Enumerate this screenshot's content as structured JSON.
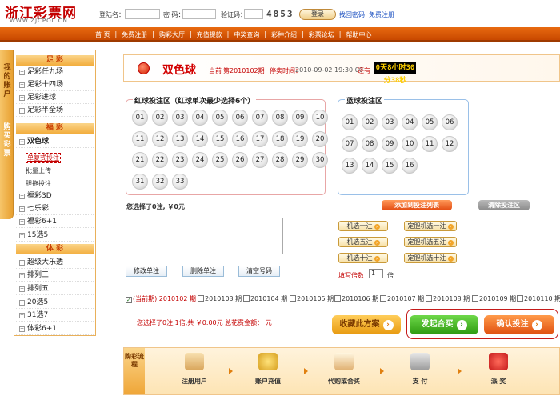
{
  "header": {
    "logo_cn": "浙江彩票网",
    "logo_en": "WWW.ZJCPOL.CN",
    "username_label": "登陆名：",
    "password_label": "密 码：",
    "captcha_label": "验证码：",
    "captcha": "4853",
    "login": "登录",
    "forgot": "找回密码",
    "register": "免费注册"
  },
  "nav": [
    "首 页",
    "免费注册",
    "购彩大厅",
    "充值提款",
    "中奖查询",
    "彩种介绍",
    "彩票论坛",
    "帮助中心"
  ],
  "left_tab": {
    "top": "我的账户",
    "bottom": "购买彩票"
  },
  "sidebar": {
    "zucai": "足 彩",
    "zucai_items": [
      "足彩任九场",
      "足彩十四场",
      "足彩进球",
      "足彩半全场"
    ],
    "fucai": "福 彩",
    "ssq": "双色球",
    "ssq_sub": [
      "单复式投注",
      "批量上传",
      "胆拖投注"
    ],
    "fucai_items": [
      "福彩3D",
      "七乐彩",
      "福彩6+1",
      "15选5"
    ],
    "ticai": "体 彩",
    "ticai_items": [
      "超级大乐透",
      "排列三",
      "排列五",
      "20选5",
      "31选7",
      "体彩6+1"
    ]
  },
  "game": {
    "title": "双色球",
    "current_label": "当前",
    "period": "第2010102期",
    "deadline_label": "停卖时间：",
    "deadline": "2010-09-02 19:30:00",
    "remaining_label": "还有",
    "countdown": "0天8小时30分38秒"
  },
  "red": {
    "title": "红球投注区（红球单次最少选择6个）",
    "balls": [
      "01",
      "02",
      "03",
      "04",
      "05",
      "06",
      "07",
      "08",
      "09",
      "10",
      "11",
      "12",
      "13",
      "14",
      "15",
      "16",
      "17",
      "18",
      "19",
      "20",
      "21",
      "22",
      "23",
      "24",
      "25",
      "26",
      "27",
      "28",
      "29",
      "30",
      "31",
      "32",
      "33"
    ]
  },
  "blue": {
    "title": "蓝球投注区",
    "balls": [
      "01",
      "02",
      "03",
      "04",
      "05",
      "06",
      "07",
      "08",
      "09",
      "10",
      "11",
      "12",
      "13",
      "14",
      "15",
      "16"
    ]
  },
  "actions": {
    "add": "添加到投注列表",
    "clear": "清除投注区"
  },
  "selected_text": "您选择了0注, ￥0元",
  "list_buttons": {
    "modify": "修改单注",
    "delete": "删除单注",
    "clear": "清空号码"
  },
  "random_buttons": [
    "机选一注",
    "定胆机选一注",
    "机选五注",
    "定胆机选五注",
    "机选十注",
    "定胆机选十注"
  ],
  "multiple_label": "填写倍数",
  "multiple_value": "1",
  "multiple_unit": "倍",
  "periods": [
    "(当前期) 2010102 期",
    "2010103 期",
    "2010104 期",
    "2010105 期",
    "2010106 期",
    "2010107 期",
    "2010108 期",
    "2010109 期",
    "2010110 期"
  ],
  "summary": "您选择了0注,1倍,共 ￥0.00元  总花费金额： 元",
  "big_buttons": {
    "collect": "收藏此方案",
    "group": "发起合买",
    "confirm": "确认投注"
  },
  "process": {
    "label": "购彩流程",
    "steps": [
      "注册用户",
      "账户充值",
      "代购或合买",
      "支 付",
      "派 奖"
    ]
  },
  "colors": {
    "brand": "#d20000",
    "nav": "#e06010",
    "accent": "#f2ad3e",
    "green": "#3aa21a"
  }
}
